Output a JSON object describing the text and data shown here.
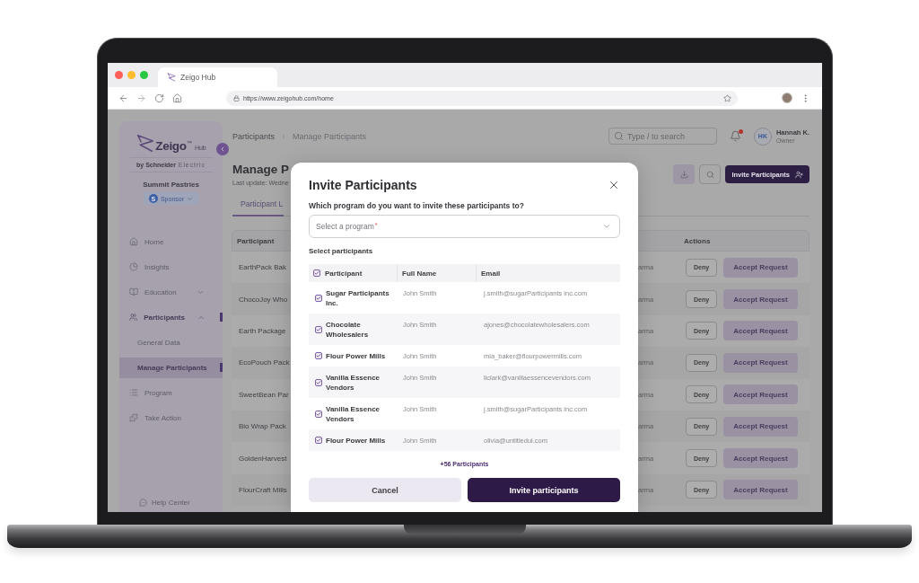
{
  "browser": {
    "tab_title": "Zeigo Hub",
    "url": "https://www.zeigohub.com/home"
  },
  "sidebar": {
    "logo": {
      "wordmark": "Zeigo",
      "trademark": "™",
      "product": "Hub",
      "byline": "**by Schneider** Electric"
    },
    "organization": "Summit Pastries",
    "role": {
      "initial": "S",
      "label": "Sponsor"
    },
    "items": [
      {
        "kind": "link",
        "label": "Home",
        "selected": false
      },
      {
        "kind": "link",
        "label": "Insights",
        "selected": false
      },
      {
        "kind": "group",
        "label": "Education",
        "selected": false,
        "expanded": false
      },
      {
        "kind": "group",
        "label": "Participants",
        "selected": true,
        "expanded": true,
        "children": [
          {
            "label": "General Data",
            "selected": false
          },
          {
            "label": "Manage Participants",
            "selected": true
          }
        ]
      },
      {
        "kind": "link",
        "label": "Program",
        "selected": false
      },
      {
        "kind": "link",
        "label": "Take Action",
        "selected": false
      }
    ],
    "help": "Help Center"
  },
  "header": {
    "breadcrumb": [
      "Participants",
      "Manage Participants"
    ],
    "search": {
      "placeholder": "Type / to search"
    },
    "unread_notifications": true,
    "user": {
      "initials": "HK",
      "name": "Hannah K.",
      "role": "Owner"
    }
  },
  "page": {
    "title": "Manage P",
    "subtitle": "Last update: Wedne",
    "invite_button": "Invite Participants",
    "tabs": [
      {
        "label": "Participant L",
        "selected": true
      }
    ],
    "table": {
      "columns": {
        "participant": "Participant",
        "actions": "Actions"
      },
      "rows": [
        {
          "participant": "EarthPack Bak",
          "column_3": "arma",
          "deny": "Deny",
          "accept": "Accept Request"
        },
        {
          "participant": "ChocoJoy Who",
          "column_3": "arma",
          "deny": "Deny",
          "accept": "Accept Request"
        },
        {
          "participant": "Earth Package",
          "column_3": "arma",
          "deny": "Deny",
          "accept": "Accept Request"
        },
        {
          "participant": "EcoPouch Pack",
          "column_3": "arma",
          "deny": "Deny",
          "accept": "Accept Request"
        },
        {
          "participant": "SweetBean Par",
          "column_3": "arma",
          "deny": "Deny",
          "accept": "Accept Request"
        },
        {
          "participant": "Bio Wrap Pack",
          "column_3": "arma",
          "deny": "Deny",
          "accept": "Accept Request"
        },
        {
          "participant": "GoldenHarvest",
          "column_3": "arma",
          "deny": "Deny",
          "accept": "Accept Request"
        },
        {
          "participant": "FlourCraft Mills",
          "column_3": "arma",
          "deny": "Deny",
          "accept": "Accept Request"
        }
      ]
    }
  },
  "modal": {
    "title": "Invite Participants",
    "question": "Which program do you want to invite these participants to?",
    "program_select": {
      "placeholder": "Select a program",
      "required_mark": "*"
    },
    "section_label": "Select participants",
    "table": {
      "header_checked": true,
      "columns": [
        "Participant",
        "Full Name",
        "Email"
      ],
      "rows": [
        {
          "participant": "Sugar Participants Inc.",
          "full_name": "John Smith",
          "email": "j.smith@sugarParticipants inc.com",
          "checked": true
        },
        {
          "participant": "Chocolate Wholesalers",
          "full_name": "John Smith",
          "email": "ajones@chocolatewholesalers.com",
          "checked": true
        },
        {
          "participant": "Flour Power Mills",
          "full_name": "John Smith",
          "email": "mia_baker@flourpowermills.com",
          "checked": true
        },
        {
          "participant": "Vanilla Essence Vendors",
          "full_name": "John Smith",
          "email": "liclark@vanillaessencevendors.com",
          "checked": true
        },
        {
          "participant": "Vanilla Essence Vendors",
          "full_name": "John Smith",
          "email": "j.smith@sugarParticipants inc.com",
          "checked": true
        },
        {
          "participant": "Flour Power Mills",
          "full_name": "John Smith",
          "email": "olivia@untitledui.com",
          "checked": true
        }
      ]
    },
    "more_link": "+56 Participants",
    "cancel_button": "Cancel",
    "confirm_button": "Invite participants"
  }
}
